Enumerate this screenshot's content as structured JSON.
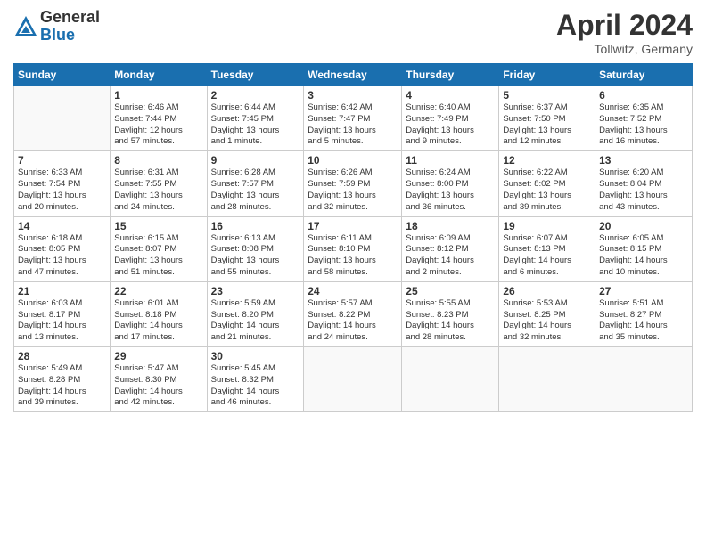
{
  "header": {
    "logo_general": "General",
    "logo_blue": "Blue",
    "month_title": "April 2024",
    "location": "Tollwitz, Germany"
  },
  "days_of_week": [
    "Sunday",
    "Monday",
    "Tuesday",
    "Wednesday",
    "Thursday",
    "Friday",
    "Saturday"
  ],
  "weeks": [
    [
      {
        "day": "",
        "info": ""
      },
      {
        "day": "1",
        "info": "Sunrise: 6:46 AM\nSunset: 7:44 PM\nDaylight: 12 hours\nand 57 minutes."
      },
      {
        "day": "2",
        "info": "Sunrise: 6:44 AM\nSunset: 7:45 PM\nDaylight: 13 hours\nand 1 minute."
      },
      {
        "day": "3",
        "info": "Sunrise: 6:42 AM\nSunset: 7:47 PM\nDaylight: 13 hours\nand 5 minutes."
      },
      {
        "day": "4",
        "info": "Sunrise: 6:40 AM\nSunset: 7:49 PM\nDaylight: 13 hours\nand 9 minutes."
      },
      {
        "day": "5",
        "info": "Sunrise: 6:37 AM\nSunset: 7:50 PM\nDaylight: 13 hours\nand 12 minutes."
      },
      {
        "day": "6",
        "info": "Sunrise: 6:35 AM\nSunset: 7:52 PM\nDaylight: 13 hours\nand 16 minutes."
      }
    ],
    [
      {
        "day": "7",
        "info": "Sunrise: 6:33 AM\nSunset: 7:54 PM\nDaylight: 13 hours\nand 20 minutes."
      },
      {
        "day": "8",
        "info": "Sunrise: 6:31 AM\nSunset: 7:55 PM\nDaylight: 13 hours\nand 24 minutes."
      },
      {
        "day": "9",
        "info": "Sunrise: 6:28 AM\nSunset: 7:57 PM\nDaylight: 13 hours\nand 28 minutes."
      },
      {
        "day": "10",
        "info": "Sunrise: 6:26 AM\nSunset: 7:59 PM\nDaylight: 13 hours\nand 32 minutes."
      },
      {
        "day": "11",
        "info": "Sunrise: 6:24 AM\nSunset: 8:00 PM\nDaylight: 13 hours\nand 36 minutes."
      },
      {
        "day": "12",
        "info": "Sunrise: 6:22 AM\nSunset: 8:02 PM\nDaylight: 13 hours\nand 39 minutes."
      },
      {
        "day": "13",
        "info": "Sunrise: 6:20 AM\nSunset: 8:04 PM\nDaylight: 13 hours\nand 43 minutes."
      }
    ],
    [
      {
        "day": "14",
        "info": "Sunrise: 6:18 AM\nSunset: 8:05 PM\nDaylight: 13 hours\nand 47 minutes."
      },
      {
        "day": "15",
        "info": "Sunrise: 6:15 AM\nSunset: 8:07 PM\nDaylight: 13 hours\nand 51 minutes."
      },
      {
        "day": "16",
        "info": "Sunrise: 6:13 AM\nSunset: 8:08 PM\nDaylight: 13 hours\nand 55 minutes."
      },
      {
        "day": "17",
        "info": "Sunrise: 6:11 AM\nSunset: 8:10 PM\nDaylight: 13 hours\nand 58 minutes."
      },
      {
        "day": "18",
        "info": "Sunrise: 6:09 AM\nSunset: 8:12 PM\nDaylight: 14 hours\nand 2 minutes."
      },
      {
        "day": "19",
        "info": "Sunrise: 6:07 AM\nSunset: 8:13 PM\nDaylight: 14 hours\nand 6 minutes."
      },
      {
        "day": "20",
        "info": "Sunrise: 6:05 AM\nSunset: 8:15 PM\nDaylight: 14 hours\nand 10 minutes."
      }
    ],
    [
      {
        "day": "21",
        "info": "Sunrise: 6:03 AM\nSunset: 8:17 PM\nDaylight: 14 hours\nand 13 minutes."
      },
      {
        "day": "22",
        "info": "Sunrise: 6:01 AM\nSunset: 8:18 PM\nDaylight: 14 hours\nand 17 minutes."
      },
      {
        "day": "23",
        "info": "Sunrise: 5:59 AM\nSunset: 8:20 PM\nDaylight: 14 hours\nand 21 minutes."
      },
      {
        "day": "24",
        "info": "Sunrise: 5:57 AM\nSunset: 8:22 PM\nDaylight: 14 hours\nand 24 minutes."
      },
      {
        "day": "25",
        "info": "Sunrise: 5:55 AM\nSunset: 8:23 PM\nDaylight: 14 hours\nand 28 minutes."
      },
      {
        "day": "26",
        "info": "Sunrise: 5:53 AM\nSunset: 8:25 PM\nDaylight: 14 hours\nand 32 minutes."
      },
      {
        "day": "27",
        "info": "Sunrise: 5:51 AM\nSunset: 8:27 PM\nDaylight: 14 hours\nand 35 minutes."
      }
    ],
    [
      {
        "day": "28",
        "info": "Sunrise: 5:49 AM\nSunset: 8:28 PM\nDaylight: 14 hours\nand 39 minutes."
      },
      {
        "day": "29",
        "info": "Sunrise: 5:47 AM\nSunset: 8:30 PM\nDaylight: 14 hours\nand 42 minutes."
      },
      {
        "day": "30",
        "info": "Sunrise: 5:45 AM\nSunset: 8:32 PM\nDaylight: 14 hours\nand 46 minutes."
      },
      {
        "day": "",
        "info": ""
      },
      {
        "day": "",
        "info": ""
      },
      {
        "day": "",
        "info": ""
      },
      {
        "day": "",
        "info": ""
      }
    ]
  ]
}
